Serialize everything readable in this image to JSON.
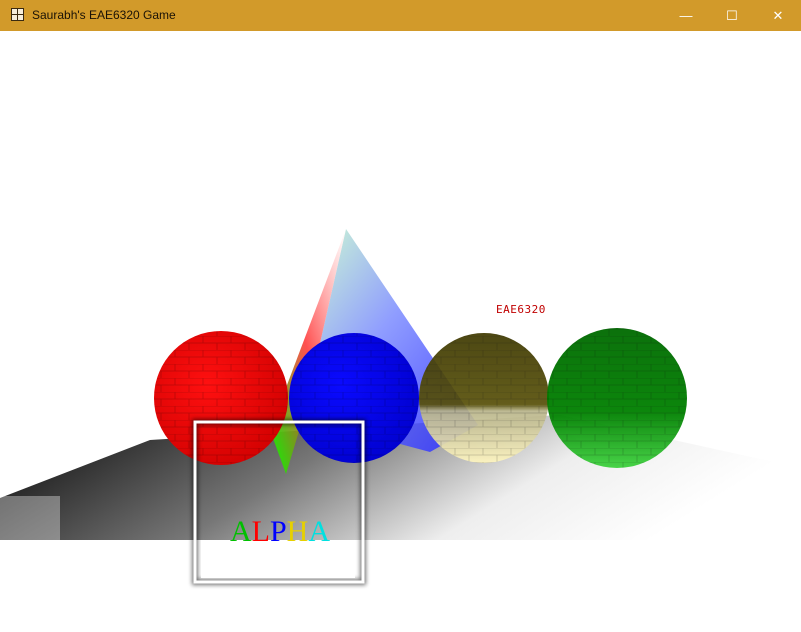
{
  "window": {
    "title": "Saurabh's EAE6320 Game",
    "minimize_glyph": "—",
    "maximize_glyph": "☐",
    "close_glyph": "✕",
    "app_icon": "game-window-icon"
  },
  "scene": {
    "world_label": "EAE6320",
    "sprite_letters": [
      {
        "char": "A",
        "color": "#00c000"
      },
      {
        "char": "L",
        "color": "#ff0000"
      },
      {
        "char": "P",
        "color": "#0000ff"
      },
      {
        "char": "H",
        "color": "#e6d000"
      },
      {
        "char": "A",
        "color": "#00e0e0"
      }
    ],
    "sphere_colors": [
      "#ff0000",
      "#0000ff",
      "#4a4200",
      "#007a00"
    ],
    "pyramid_colors": [
      "#ff2020",
      "#00ff00",
      "#2040ff"
    ],
    "floor_colors": [
      "#000000",
      "#ffffff"
    ]
  }
}
